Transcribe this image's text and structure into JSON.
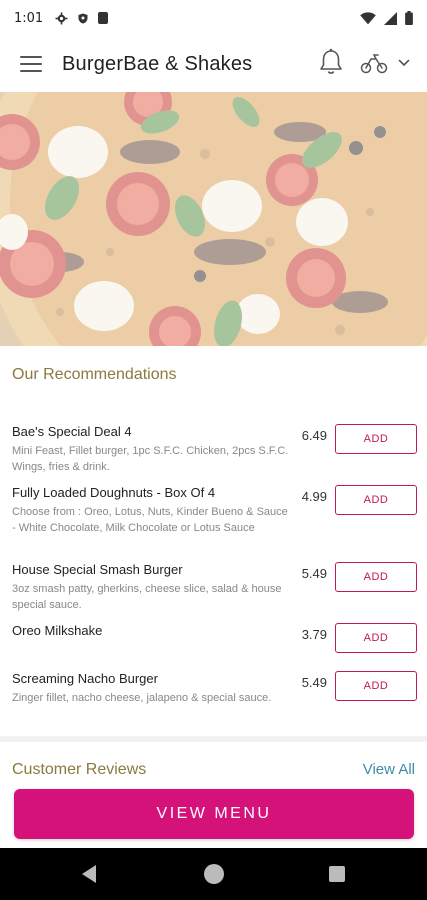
{
  "status_bar": {
    "time": "1:01",
    "icons": [
      "gear-icon",
      "shield-icon",
      "sim-card-icon"
    ],
    "right_icons": [
      "wifi-icon",
      "signal-icon",
      "battery-icon"
    ]
  },
  "app_bar": {
    "title": "BurgerBae & Shakes",
    "icons": [
      "menu-icon",
      "bell-icon",
      "scooter-icon",
      "chevron-down-icon"
    ]
  },
  "recommendations": {
    "title": "Our Recommendations",
    "add_label": "ADD",
    "items": [
      {
        "name": "Bae's Special Deal 4",
        "description": "Mini Feast, Fillet burger, 1pc S.F.C. Chicken, 2pcs S.F.C. Wings, fries & drink.",
        "price": "6.49"
      },
      {
        "name": "Fully Loaded Doughnuts - Box Of 4",
        "description": "Choose from : Oreo, Lotus, Nuts, Kinder Bueno & Sauce - White Chocolate, Milk Chocolate or Lotus Sauce",
        "price": "4.99"
      },
      {
        "name": "House Special Smash Burger",
        "description": "3oz smash patty, gherkins, cheese slice, salad & house special sauce.",
        "price": "5.49"
      },
      {
        "name": "Oreo Milkshake",
        "description": "",
        "price": "3.79"
      },
      {
        "name": "Screaming Nacho Burger",
        "description": "Zinger fillet, nacho cheese, jalapeno & special sauce.",
        "price": "5.49"
      }
    ]
  },
  "reviews": {
    "title": "Customer Reviews",
    "view_all_label": "View All"
  },
  "view_menu_label": "VIEW MENU",
  "colors": {
    "accent": "#d5117a",
    "add_border": "#c2185b",
    "section_title": "#8a7a3e",
    "link": "#3b8ca8"
  }
}
